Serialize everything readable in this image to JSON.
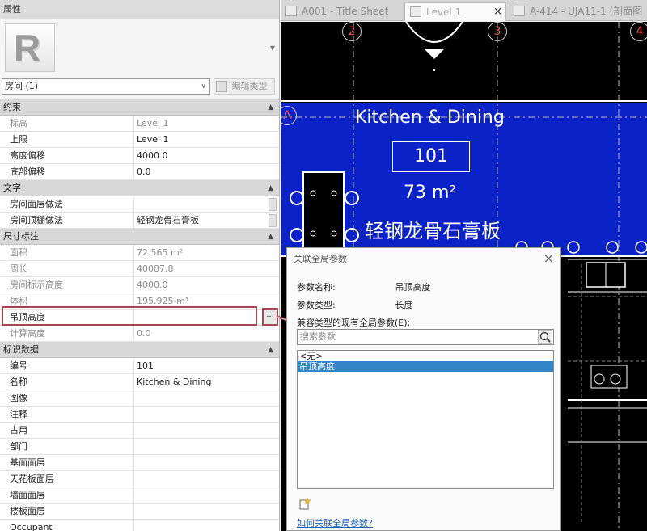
{
  "properties": {
    "title": "属性",
    "logo_letter": "R",
    "category": "房间 (1)",
    "edit_type": "编辑类型",
    "groups": [
      {
        "name": "约束",
        "rows": [
          {
            "label": "标高",
            "value": "Level 1",
            "readonly": true
          },
          {
            "label": "上限",
            "value": "Level 1",
            "readonly": false
          },
          {
            "label": "高度偏移",
            "value": "4000.0",
            "readonly": false
          },
          {
            "label": "底部偏移",
            "value": "0.0",
            "readonly": false
          }
        ]
      },
      {
        "name": "文字",
        "rows": [
          {
            "label": "房间面层做法",
            "value": "",
            "readonly": false
          },
          {
            "label": "房间顶棚做法",
            "value": "轻钢龙骨石膏板",
            "readonly": false
          }
        ]
      },
      {
        "name": "尺寸标注",
        "rows": [
          {
            "label": "面积",
            "value": "72.565 m²",
            "readonly": true
          },
          {
            "label": "周长",
            "value": "40087.8",
            "readonly": true
          },
          {
            "label": "房间标示高度",
            "value": "4000.0",
            "readonly": true
          },
          {
            "label": "体积",
            "value": "195.925 m³",
            "readonly": true
          },
          {
            "label": "吊顶高度",
            "value": "",
            "readonly": false
          },
          {
            "label": "计算高度",
            "value": "0.0",
            "readonly": true
          }
        ]
      },
      {
        "name": "标识数据",
        "rows": [
          {
            "label": "编号",
            "value": "101",
            "readonly": false
          },
          {
            "label": "名称",
            "value": "Kitchen & Dining",
            "readonly": false
          },
          {
            "label": "图像",
            "value": "",
            "readonly": false
          },
          {
            "label": "注释",
            "value": "",
            "readonly": false
          },
          {
            "label": "占用",
            "value": "",
            "readonly": false
          },
          {
            "label": "部门",
            "value": "",
            "readonly": false
          },
          {
            "label": "基面面层",
            "value": "",
            "readonly": false
          },
          {
            "label": "天花板面层",
            "value": "",
            "readonly": false
          },
          {
            "label": "墙面面层",
            "value": "",
            "readonly": false
          },
          {
            "label": "楼板面层",
            "value": "",
            "readonly": false
          },
          {
            "label": "Occupant",
            "value": "",
            "readonly": false
          }
        ]
      }
    ],
    "assoc_button": "..."
  },
  "tabs": [
    {
      "label": "A001 - Title Sheet",
      "active": false
    },
    {
      "label": "Level 1",
      "active": true
    },
    {
      "label": "A-414 - UJA11-1 (剖面图",
      "active": false
    }
  ],
  "canvas": {
    "room_name": "Kitchen & Dining",
    "room_number": "101",
    "room_area": "73 m²",
    "ceiling": "轻钢龙骨石膏板",
    "grid_bubbles": [
      "2",
      "3",
      "4",
      "A"
    ],
    "room_fill_color": "#0a22c8"
  },
  "dialog": {
    "title": "关联全局参数",
    "close": "×",
    "param_name_label": "参数名称:",
    "param_name_value": "吊顶高度",
    "param_type_label": "参数类型:",
    "param_type_value": "长度",
    "compatible_label": "兼容类型的现有全局参数(E):",
    "search_placeholder": "搜索参数",
    "options": [
      "<无>",
      "吊顶高度"
    ],
    "selected_option": "吊顶高度",
    "help_link": "如何关联全局参数?"
  },
  "colors": {
    "highlight": "#a14853",
    "selection": "#3285c6"
  }
}
